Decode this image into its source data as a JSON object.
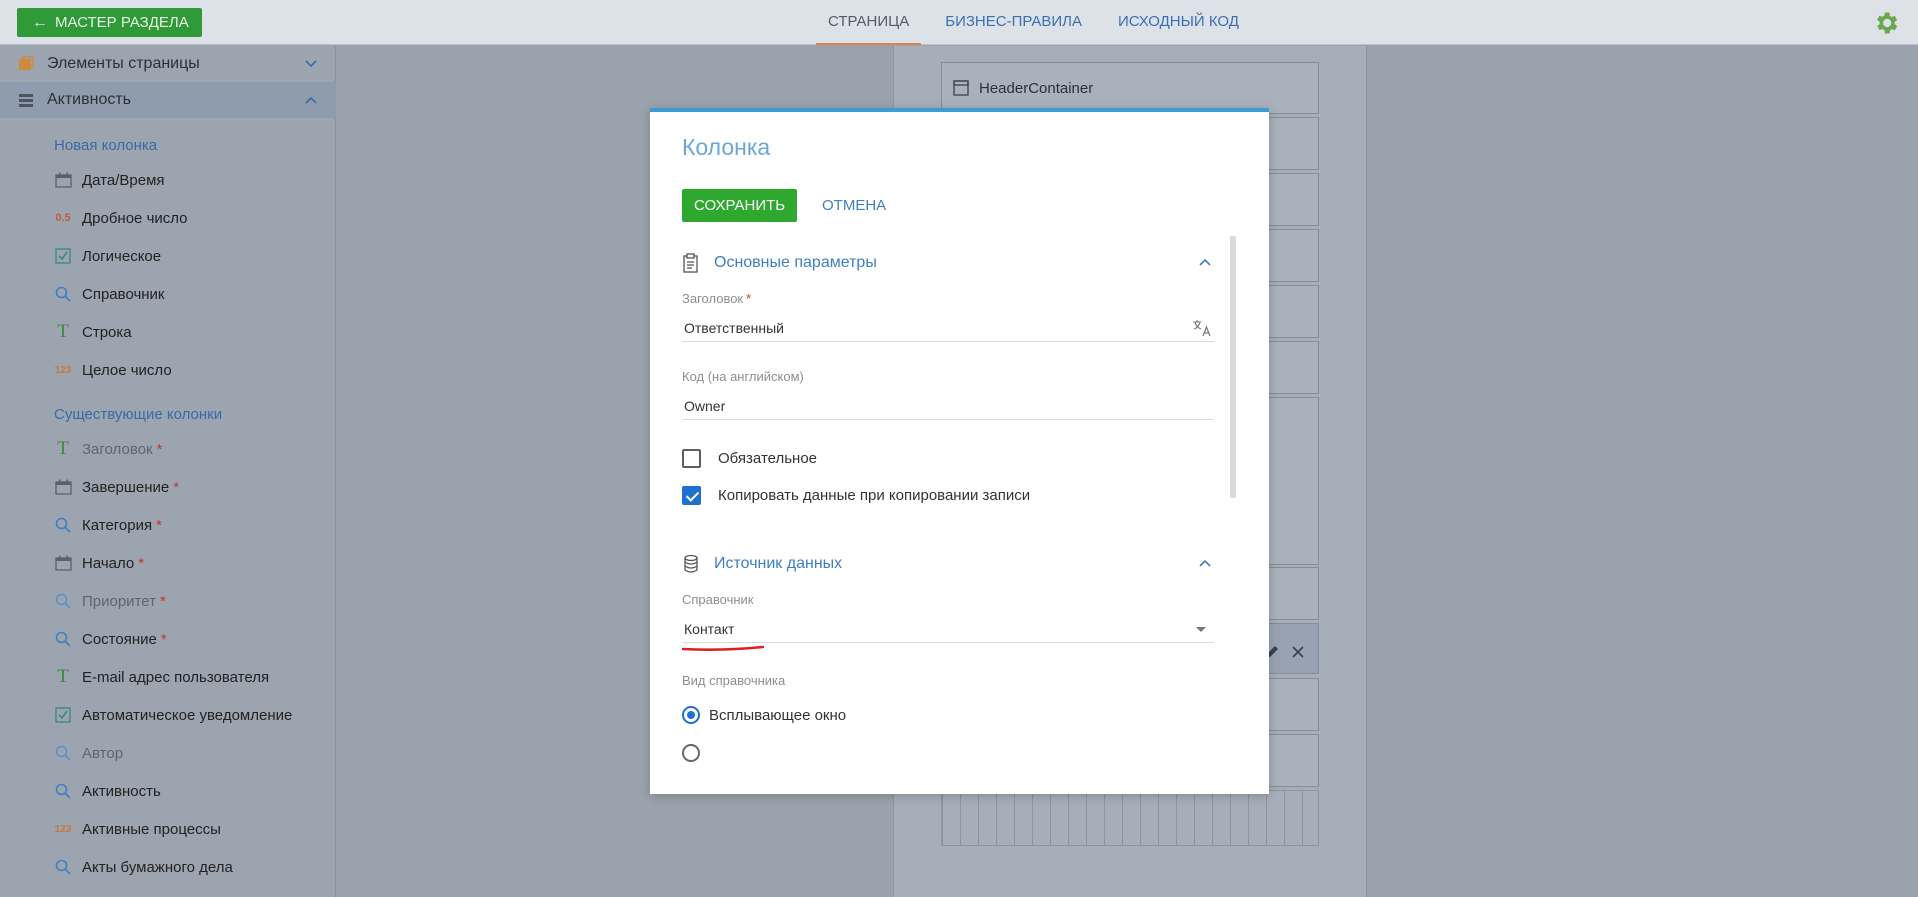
{
  "topbar": {
    "wizard_label": "МАСТЕР РАЗДЕЛА",
    "tabs": [
      {
        "label": "СТРАНИЦА",
        "active": true
      },
      {
        "label": "БИЗНЕС-ПРАВИЛА",
        "active": false
      },
      {
        "label": "ИСХОДНЫЙ КОД",
        "active": false
      }
    ]
  },
  "sidebar": {
    "sections": [
      {
        "label": "Элементы страницы",
        "expanded": false
      },
      {
        "label": "Активность",
        "expanded": true
      }
    ],
    "new_columns_title": "Новая колонка",
    "new_columns": [
      {
        "label": "Дата/Время",
        "icon": "calendar-icon"
      },
      {
        "label": "Дробное число",
        "icon": "decimal-icon",
        "badge": "0.5"
      },
      {
        "label": "Логическое",
        "icon": "checkbox-icon"
      },
      {
        "label": "Справочник",
        "icon": "lookup-search-icon"
      },
      {
        "label": "Строка",
        "icon": "text-t-icon",
        "badge": "T"
      },
      {
        "label": "Целое число",
        "icon": "integer-icon",
        "badge": "123"
      }
    ],
    "existing_columns_title": "Существующие колонки",
    "existing_columns": [
      {
        "label": "Заголовок",
        "icon": "text-t-icon",
        "badge": "T",
        "required": "*",
        "dim": true
      },
      {
        "label": "Завершение",
        "icon": "calendar-icon",
        "required": "*",
        "dim": false
      },
      {
        "label": "Категория",
        "icon": "lookup-search-icon",
        "required": "*",
        "dim": false
      },
      {
        "label": "Начало",
        "icon": "calendar-icon",
        "required": "*",
        "dim": false
      },
      {
        "label": "Приоритет",
        "icon": "lookup-search-icon",
        "required": "*",
        "dim": true
      },
      {
        "label": "Состояние",
        "icon": "lookup-search-icon",
        "required": "*",
        "dim": false
      },
      {
        "label": "E-mail адрес пользователя",
        "icon": "text-t-icon",
        "badge": "T",
        "required": "",
        "dim": false
      },
      {
        "label": "Автоматическое уведомление",
        "icon": "checkbox-icon",
        "required": "",
        "dim": false
      },
      {
        "label": "Автор",
        "icon": "lookup-search-icon",
        "required": "",
        "dim": true
      },
      {
        "label": "Активность",
        "icon": "lookup-search-icon",
        "required": "",
        "dim": false
      },
      {
        "label": "Активные процессы",
        "icon": "integer-icon",
        "badge": "123",
        "required": "",
        "dim": false
      },
      {
        "label": "Акты бумажного дела",
        "icon": "lookup-search-icon",
        "required": "",
        "dim": false
      }
    ]
  },
  "canvas": {
    "header_container_label": "HeaderContainer"
  },
  "modal": {
    "title": "Колонка",
    "save_label": "СОХРАНИТЬ",
    "cancel_label": "ОТМЕНА",
    "main_section": {
      "title": "Основные параметры",
      "caption_label": "Заголовок",
      "caption_required": "*",
      "caption_value": "Ответственный",
      "code_label": "Код (на английском)",
      "code_value": "Owner",
      "required_checkbox": {
        "label": "Обязательное",
        "checked": false
      },
      "copy_checkbox": {
        "label": "Копировать данные при копировании записи",
        "checked": true
      }
    },
    "source_section": {
      "title": "Источник данных",
      "lookup_label": "Справочник",
      "lookup_value": "Контакт",
      "lookup_kind_label": "Вид справочника",
      "lookup_kind_options": [
        {
          "label": "Всплывающее окно",
          "selected": true
        },
        {
          "label": "",
          "selected": false
        }
      ]
    }
  },
  "colors": {
    "accent_green": "#2ea82f",
    "link_blue": "#3d7ec4",
    "tab_underline": "#e0833f",
    "modal_top_border": "#3c9ad6",
    "annotation_red": "#e0201a"
  }
}
